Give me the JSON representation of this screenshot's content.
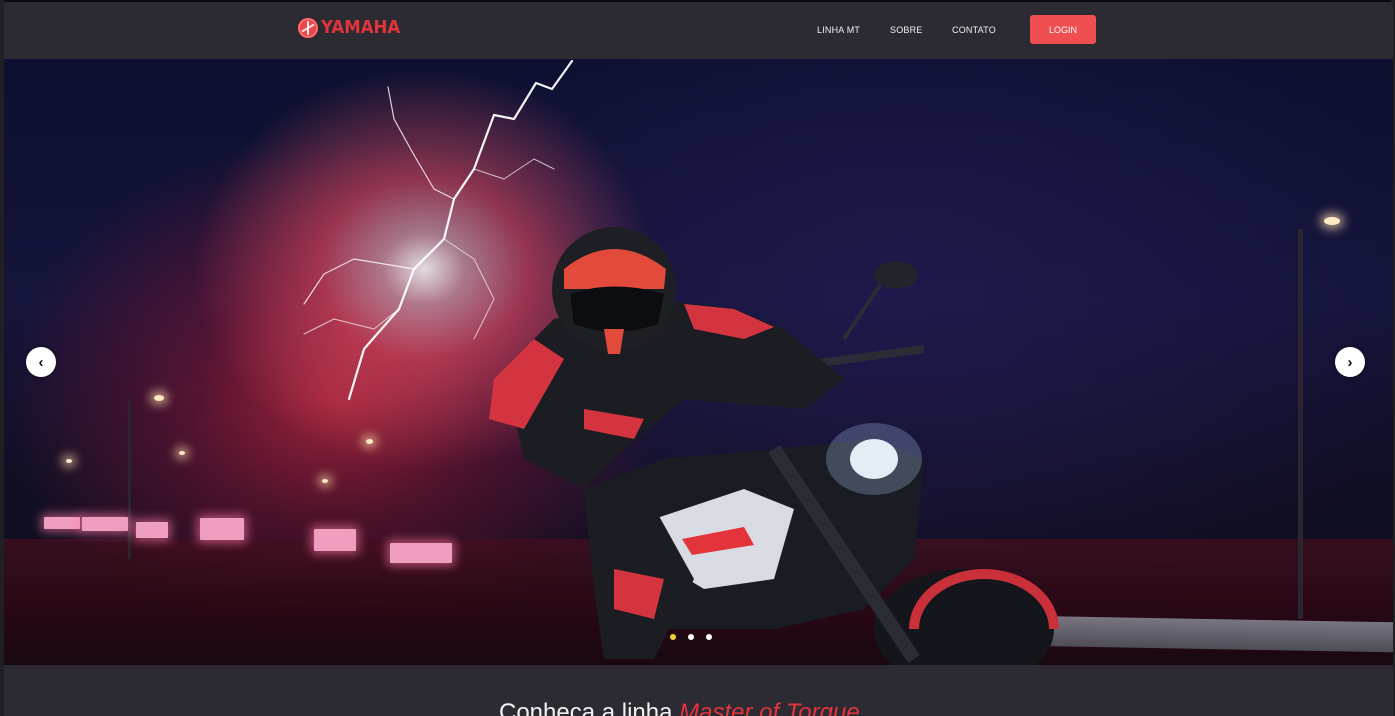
{
  "header": {
    "brand": "YAMAHA",
    "nav": [
      {
        "label": "LINHA MT"
      },
      {
        "label": "SOBRE"
      },
      {
        "label": "CONTATO"
      }
    ],
    "login_label": "LOGIN"
  },
  "carousel": {
    "prev_symbol": "‹",
    "next_symbol": "›",
    "dots": 3,
    "active_dot": 0
  },
  "section": {
    "title_prefix": "Conheça a linha ",
    "title_accent": "Master of Torque"
  },
  "colors": {
    "header_bg": "#2c2b33",
    "brand_red": "#e3343c",
    "login_bg": "#f04f51",
    "active_dot": "#f2d22e"
  },
  "icons": {
    "logo": "yamaha-tuning-fork-icon",
    "prev": "chevron-left-icon",
    "next": "chevron-right-icon"
  }
}
